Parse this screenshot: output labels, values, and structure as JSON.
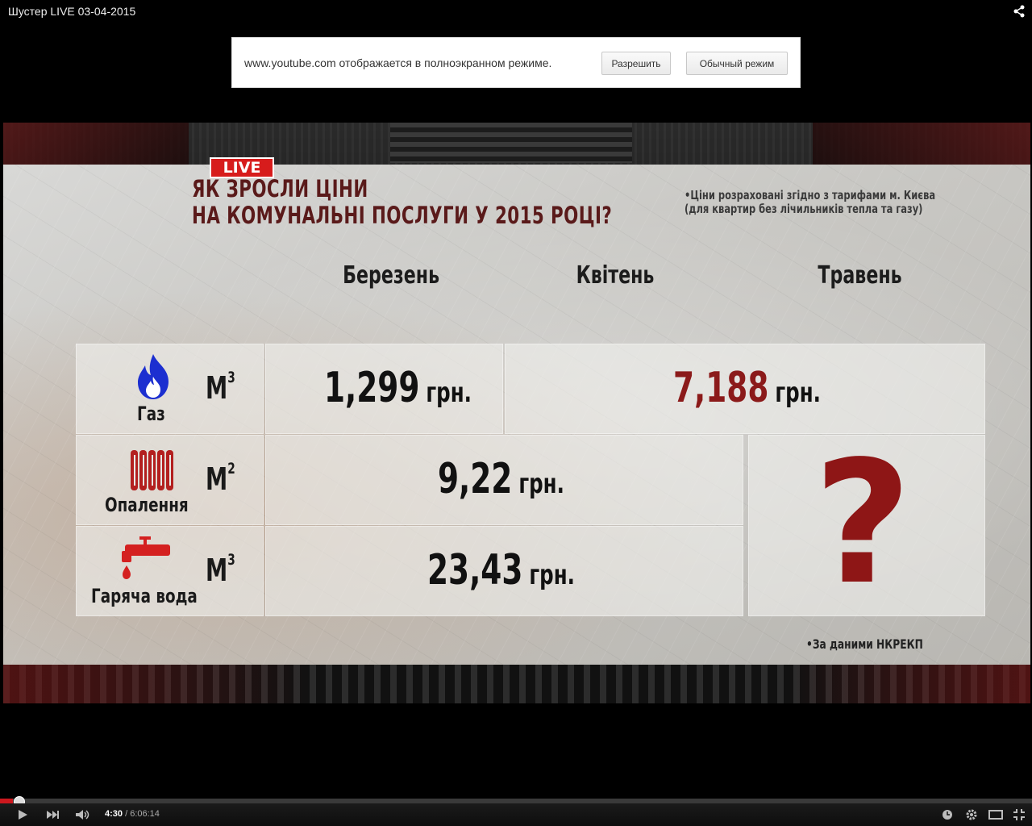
{
  "window": {
    "title": "Шустер LIVE 03-04-2015"
  },
  "fullscreen_notice": {
    "text": "www.youtube.com отображается в полноэкранном режиме.",
    "allow_label": "Разрешить",
    "normal_label": "Обычный режим"
  },
  "infographic": {
    "live_badge": "LIVE",
    "headline_line1": "ЯК ЗРОСЛИ ЦІНИ",
    "headline_line2": "НА КОМУНАЛЬНІ ПОСЛУГИ У 2015 РОЦІ?",
    "note_line1": "•Ціни розраховані згідно з тарифами м. Києва",
    "note_line2": "(для квартир без лічильників тепла та газу)",
    "months": [
      "Березень",
      "Квітень",
      "Травень"
    ],
    "rows": [
      {
        "name": "Газ",
        "unit": "М",
        "unit_power": "3",
        "icon": "flame-icon"
      },
      {
        "name": "Опалення",
        "unit": "М",
        "unit_power": "2",
        "icon": "radiator-icon"
      },
      {
        "name": "Гаряча вода",
        "unit": "М",
        "unit_power": "3",
        "icon": "tap-icon"
      }
    ],
    "values": {
      "gas_march": "1,299",
      "gas_april": "7,188",
      "heating": "9,22",
      "hot_water": "23,43",
      "currency": "грн.",
      "may": "?"
    },
    "source": "•За даними НКРЕКП",
    "colors": {
      "accent_red": "#8b1a1a",
      "live_red": "#d71c1c",
      "icon_blue": "#1c2fd0"
    }
  },
  "player": {
    "current_time": "4:30",
    "separator": " / ",
    "total_time": "6:06:14",
    "progress": 0.0123
  }
}
